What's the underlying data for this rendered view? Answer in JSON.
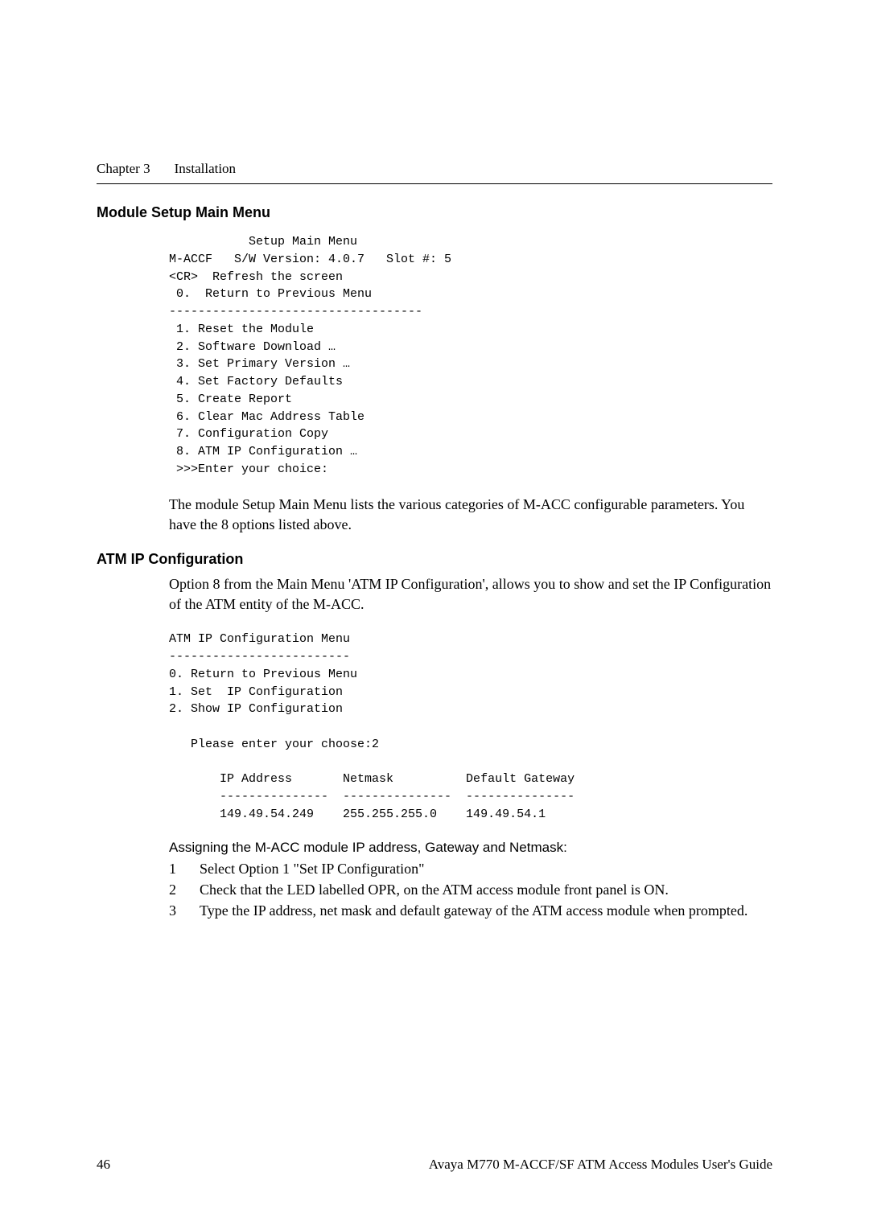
{
  "header": {
    "chapter": "Chapter 3",
    "title": "Installation"
  },
  "section1": {
    "heading": "Module Setup Main Menu",
    "code": "           Setup Main Menu\nM-ACCF   S/W Version: 4.0.7   Slot #: 5\n<CR>  Refresh the screen\n 0.  Return to Previous Menu\n-----------------------------------\n 1. Reset the Module\n 2. Software Download …\n 3. Set Primary Version …\n 4. Set Factory Defaults\n 5. Create Report\n 6. Clear Mac Address Table\n 7. Configuration Copy\n 8. ATM IP Configuration …\n >>>Enter your choice:",
    "paragraph": "The module Setup Main Menu lists the various categories of M-ACC configurable parameters. You have the 8 options listed above."
  },
  "section2": {
    "heading": "ATM IP Configuration",
    "paragraph": "Option 8 from the Main Menu 'ATM IP Configuration', allows you to show and set the IP Configuration of the ATM entity of the M-ACC.",
    "code": "ATM IP Configuration Menu\n-------------------------\n0. Return to Previous Menu\n1. Set  IP Configuration\n2. Show IP Configuration\n\n   Please enter your choose:2\n\n       IP Address       Netmask          Default Gateway\n       ---------------  ---------------  ---------------\n       149.49.54.249    255.255.255.0    149.49.54.1",
    "assign_heading": "Assigning the M-ACC module IP address, Gateway and Netmask:",
    "items": [
      {
        "num": "1",
        "text": "Select Option 1 \"Set IP Configuration\""
      },
      {
        "num": "2",
        "text": "Check that the LED labelled OPR, on the ATM access module front panel is ON."
      },
      {
        "num": "3",
        "text": "Type the IP address, net mask and default gateway of the ATM access module when prompted."
      }
    ]
  },
  "footer": {
    "page_number": "46",
    "doc_title": "Avaya M770 M-ACCF/SF ATM Access Modules User's Guide"
  },
  "chart_data": {
    "type": "table",
    "title": "IP Configuration",
    "columns": [
      "IP Address",
      "Netmask",
      "Default Gateway"
    ],
    "rows": [
      [
        "149.49.54.249",
        "255.255.255.0",
        "149.49.54.1"
      ]
    ]
  }
}
